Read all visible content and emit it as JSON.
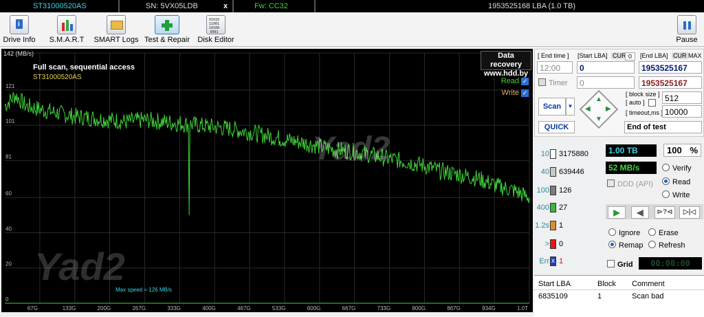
{
  "status_bar": {
    "model": "ST31000520AS",
    "serial": "SN: 5VX05LDB",
    "close_glyph": "x",
    "firmware": "Fw: CC32",
    "capacity": "1953525168 LBA (1.0 TB)"
  },
  "toolbar": {
    "items": [
      {
        "label": "Drive Info",
        "icon": "info-icon"
      },
      {
        "label": "S.M.A.R.T",
        "icon": "smart-chart-icon"
      },
      {
        "label": "SMART Logs",
        "icon": "logs-icon"
      },
      {
        "label": "Test & Repair",
        "icon": "plus-icon",
        "active": true
      },
      {
        "label": "Disk Editor",
        "icon": "binary-editor-icon"
      }
    ],
    "pause_label": "Pause"
  },
  "graph": {
    "unit_label": "142 (MB/s)",
    "y_ticks": [
      "142",
      "121",
      "101",
      "81",
      "60",
      "40",
      "20",
      "0"
    ],
    "x_ticks": [
      "67G",
      "133G",
      "200G",
      "267G",
      "333G",
      "400G",
      "467G",
      "533G",
      "600G",
      "667G",
      "733G",
      "800G",
      "867G",
      "934G",
      "1.0T"
    ],
    "title": "Full scan, sequential access",
    "model": "ST31000520AS",
    "data_recovery_line1": "Data recovery",
    "data_recovery_line2": "www.hdd.by",
    "read_label": "Read",
    "write_label": "Write",
    "max_speed": "Max speed = 126 MB/s",
    "watermark": "Yad2",
    "colors": {
      "read": "#3fd63a",
      "write": "#e0b060",
      "grid": "#2a2a2a"
    }
  },
  "chart_data": {
    "type": "line",
    "title": "Full scan, sequential access",
    "xlabel": "",
    "ylabel": "MB/s",
    "xlim": [
      0,
      1000
    ],
    "ylim": [
      0,
      142
    ],
    "series": [
      {
        "name": "Read",
        "x": [
          0,
          20,
          40,
          67,
          100,
          133,
          170,
          200,
          230,
          267,
          300,
          333,
          370,
          400,
          430,
          467,
          500,
          533,
          570,
          600,
          630,
          667,
          700,
          733,
          770,
          800,
          830,
          867,
          900,
          934,
          970,
          1000
        ],
        "values": [
          112,
          118,
          112,
          110,
          108,
          106,
          105,
          104,
          103,
          104,
          103,
          102,
          101,
          100,
          99,
          97,
          95,
          93,
          91,
          89,
          87,
          86,
          84,
          82,
          80,
          78,
          75,
          73,
          71,
          67,
          64,
          60
        ]
      }
    ]
  },
  "controls": {
    "end_time_label": "[ End time ]",
    "start_lba_label": "[Start LBA]",
    "cur_label": "CUR",
    "cur_value": "0",
    "end_lba_label": "[End LBA]",
    "end_cur_label": "CUR",
    "max_label": "MAX",
    "end_time_value": "12:00",
    "start_lba_value": "0",
    "end_lba_value": "1953525167",
    "timer_label": "Timer",
    "timer_value": "0",
    "end_lba_value2": "1953525167",
    "block_size_label": "[ block size ]",
    "auto_label": "[ auto ]",
    "block_size_value": "512",
    "timeout_label": "[ timeout,ms ]",
    "timeout_value": "10000",
    "scan_label": "Scan",
    "quick_label": "QUICK",
    "end_of_test": "End of test"
  },
  "stats": {
    "rows": [
      {
        "label": "10",
        "count": "3175880",
        "color": "#ffffff"
      },
      {
        "label": "40",
        "count": "639446",
        "color": "#c8c8c8"
      },
      {
        "label": "100",
        "count": "126",
        "color": "#7d7d7d"
      },
      {
        "label": "400",
        "count": "27",
        "color": "#3db53d"
      },
      {
        "label": "1.2s",
        "count": "1",
        "color": "#e08a2a"
      },
      {
        "label": ">",
        "count": "0",
        "color": "#e01a1a"
      },
      {
        "label": "Err",
        "count": "1",
        "color": "#1e3fb0"
      }
    ],
    "err_glyph": "x",
    "capacity": "1.00 TB",
    "percent": "100",
    "percent_sign": "%",
    "speed": "52 MB/s",
    "ddd_label": "DDD (API)",
    "verify_label": "Verify",
    "read_label": "Read",
    "write_label": "Write",
    "ignore_label": "Ignore",
    "erase_label": "Erase",
    "remap_label": "Remap",
    "refresh_label": "Refresh",
    "grid_label": "Grid",
    "timer_display": "00:00:00"
  },
  "bad_blocks": {
    "headers": [
      "Start LBA",
      "Block",
      "Comment"
    ],
    "rows": [
      [
        "6835109",
        "1",
        "Scan bad"
      ]
    ]
  }
}
